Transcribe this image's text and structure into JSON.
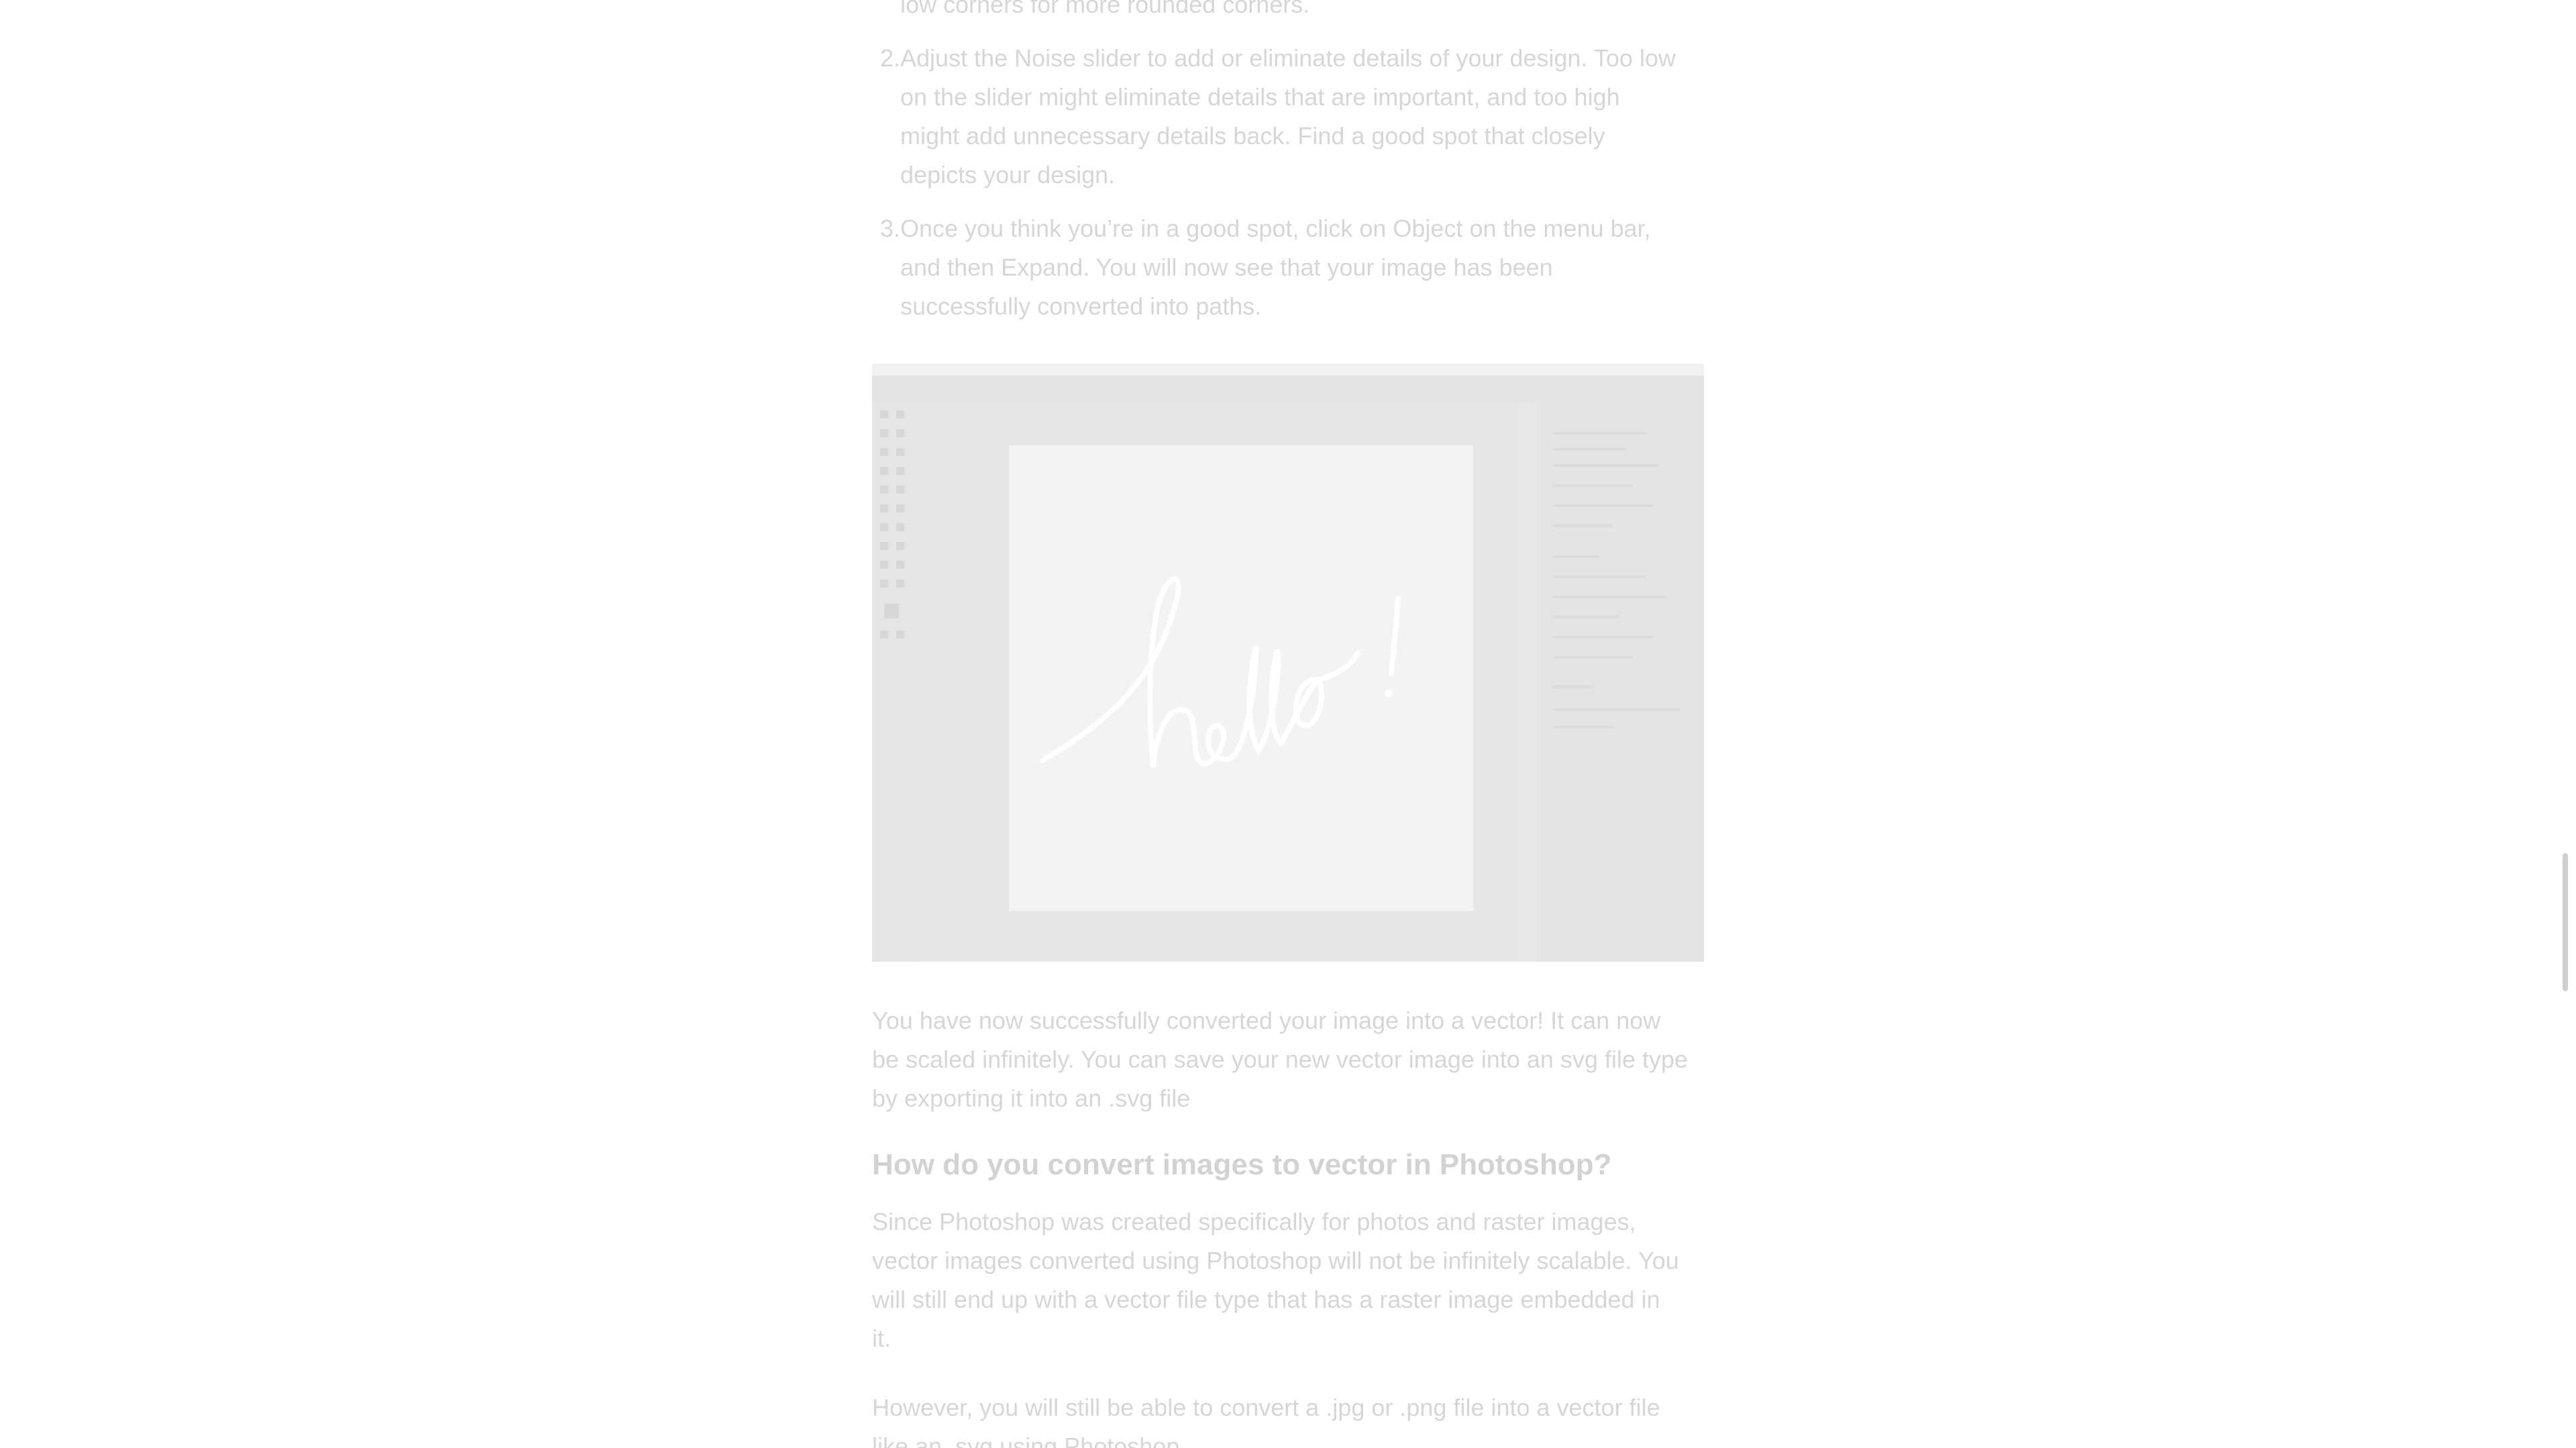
{
  "article": {
    "steps": [
      {
        "num": "",
        "lines": [
          "low corners for more rounded corners."
        ]
      },
      {
        "num": "2.",
        "lines": [
          "Adjust the Noise slider to add or eliminate details of your design. Too low",
          "on the slider might eliminate details that are important, and too high",
          "might add unnecessary details back. Find a good spot that closely",
          "depicts your design."
        ]
      },
      {
        "num": "3.",
        "lines": [
          "Once you think you’re in a good spot, click on Object on the menu bar,",
          "and then Expand. You will now see that your image has been",
          "successfully converted into paths."
        ]
      }
    ],
    "screenshot": {
      "canvas_text": "hello!"
    },
    "paragraph1": [
      "You have now successfully converted your image into a vector! It can now",
      "be scaled infinitely. You can save your new vector image into an svg file type",
      "by exporting it into an .svg file"
    ],
    "heading": "How do you convert images to vector in Photoshop?",
    "paragraph2": [
      "Since Photoshop was created specifically for photos and raster images,",
      "vector images converted using Photoshop will not be infinitely scalable. You",
      "will still end up with a vector file type that has a raster image embedded in",
      "it."
    ],
    "paragraph3": [
      "However, you will still be able to convert a .jpg or .png file into a vector file",
      "like an .svg using Photoshop."
    ]
  },
  "colors": {
    "text": "#d6d6d6",
    "heading": "#d2d2d2",
    "background": "#ffffff"
  }
}
